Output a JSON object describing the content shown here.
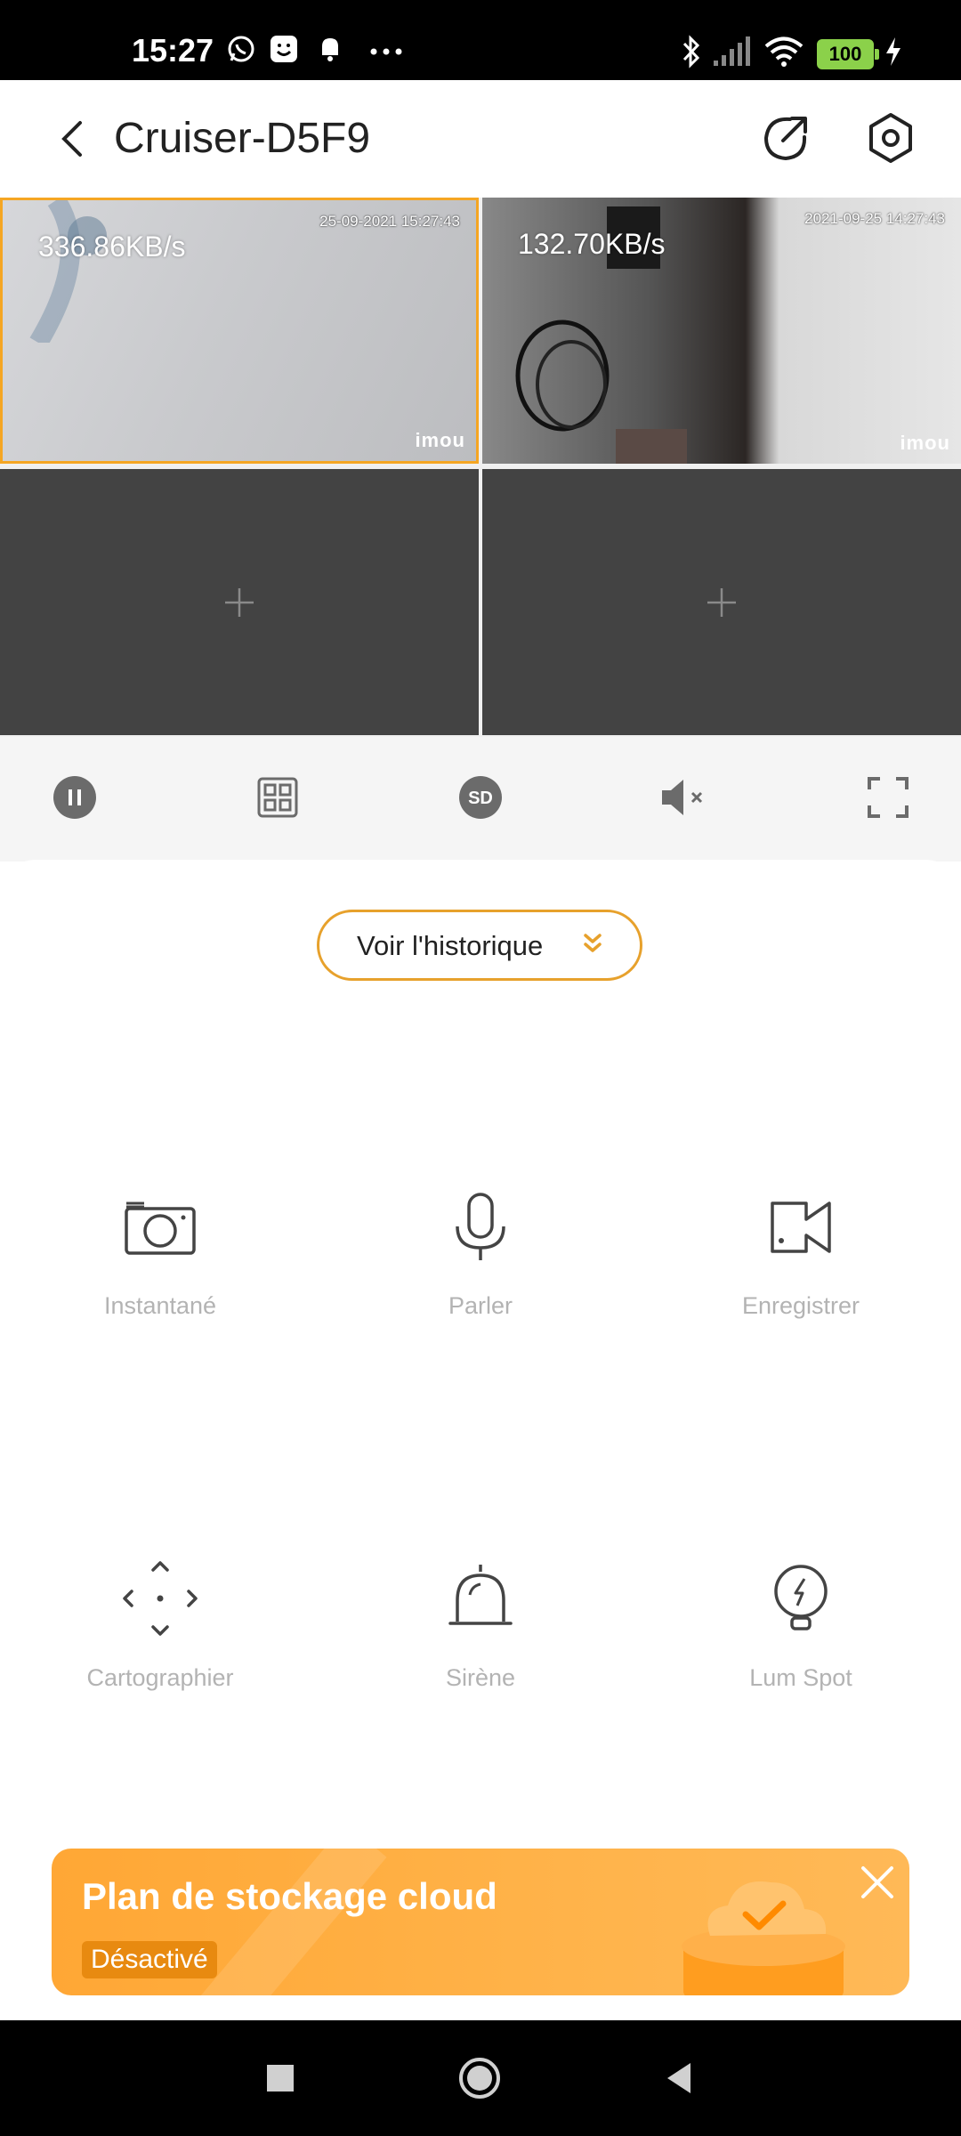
{
  "status_bar": {
    "time": "15:27",
    "battery": "100",
    "icons": [
      "whatsapp-icon",
      "smile-app-icon",
      "bell-icon",
      "more-dots-icon",
      "bluetooth-icon",
      "signal-icon",
      "wifi-icon",
      "battery-icon",
      "charging-icon"
    ]
  },
  "header": {
    "title": "Cruiser-D5F9",
    "icons": [
      "back-icon",
      "share-icon",
      "settings-icon"
    ]
  },
  "video_grid": {
    "cells": [
      {
        "speed": "336.86KB/s",
        "timestamp": "25-09-2021 15:27:43",
        "watermark": "imou"
      },
      {
        "speed": "132.70KB/s",
        "timestamp": "2021-09-25 14:27:43",
        "watermark": "imou"
      }
    ]
  },
  "controls": [
    "pause-icon",
    "grid-layout-icon",
    "sd-quality-icon",
    "mute-icon",
    "fullscreen-icon"
  ],
  "history_button": {
    "label": "Voir l'historique"
  },
  "features": [
    {
      "label": "Instantané",
      "icon": "camera-icon"
    },
    {
      "label": "Parler",
      "icon": "microphone-icon"
    },
    {
      "label": "Enregistrer",
      "icon": "video-record-icon"
    },
    {
      "label": "Cartographier",
      "icon": "map-move-icon"
    },
    {
      "label": "Sirène",
      "icon": "siren-icon"
    },
    {
      "label": "Lum Spot",
      "icon": "spotlight-icon"
    }
  ],
  "cloud_banner": {
    "title": "Plan de stockage cloud",
    "status": "Désactivé"
  },
  "nav_bar": [
    "recents-square-icon",
    "home-circle-icon",
    "back-triangle-icon"
  ],
  "colors": {
    "accent": "#e7a12c",
    "banner": "#ffa735",
    "grid_empty": "#434343"
  }
}
